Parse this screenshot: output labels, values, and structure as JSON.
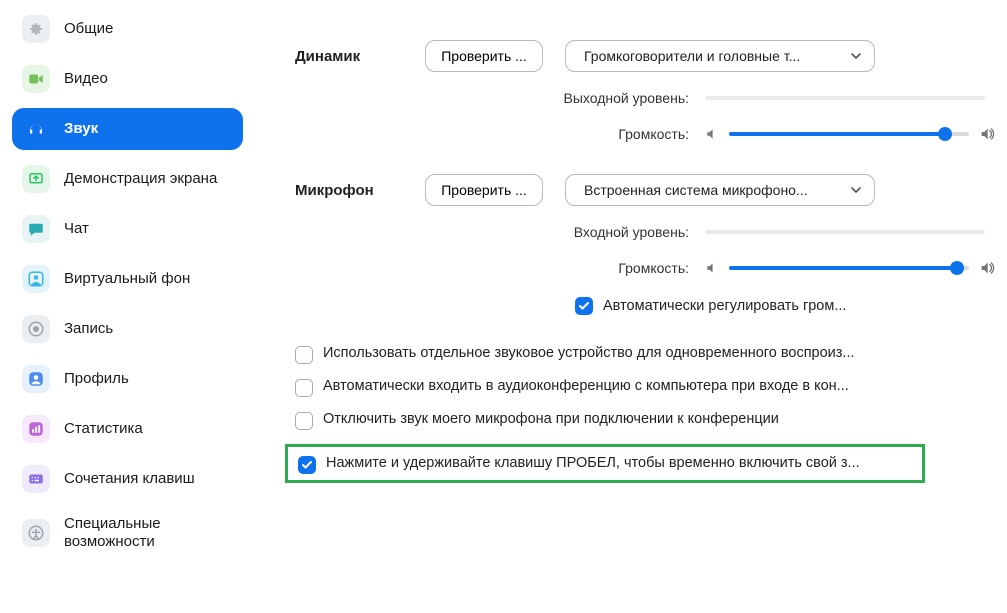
{
  "sidebar": {
    "items": [
      {
        "id": "general",
        "label": "Общие",
        "icon": "gear",
        "iconBg": "#eceff2",
        "iconFg": "#b1b7bd"
      },
      {
        "id": "video",
        "label": "Видео",
        "icon": "video",
        "iconBg": "#e7f6e5",
        "iconFg": "#76c05b"
      },
      {
        "id": "audio",
        "label": "Звук",
        "icon": "headphones",
        "iconBg": "#0e72ed",
        "iconFg": "#ffffff",
        "active": true
      },
      {
        "id": "share",
        "label": "Демонстрация экрана",
        "icon": "share",
        "iconBg": "#e6f7ea",
        "iconFg": "#28c466"
      },
      {
        "id": "chat",
        "label": "Чат",
        "icon": "chat",
        "iconBg": "#e7f3f4",
        "iconFg": "#2aaab0"
      },
      {
        "id": "vbg",
        "label": "Виртуальный фон",
        "icon": "person",
        "iconBg": "#e5f4fb",
        "iconFg": "#35b8e8"
      },
      {
        "id": "recording",
        "label": "Запись",
        "icon": "record",
        "iconBg": "#eceff2",
        "iconFg": "#9da3ab"
      },
      {
        "id": "profile",
        "label": "Профиль",
        "icon": "profile",
        "iconBg": "#e7f0fd",
        "iconFg": "#4f8ef0"
      },
      {
        "id": "stats",
        "label": "Статистика",
        "icon": "stats",
        "iconBg": "#f6e9f9",
        "iconFg": "#bd66d8"
      },
      {
        "id": "shortcuts",
        "label": "Сочетания клавиш",
        "icon": "keyboard",
        "iconBg": "#efeafc",
        "iconFg": "#8a6fe8"
      },
      {
        "id": "access",
        "label": "Специальные возможности",
        "icon": "access",
        "iconBg": "#eceff2",
        "iconFg": "#9da3ab"
      }
    ]
  },
  "speaker": {
    "heading": "Динамик",
    "test_btn": "Проверить ...",
    "device_selected": "Громкоговорители и головные т...",
    "output_level_label": "Выходной уровень:",
    "volume_label": "Громкость:",
    "volume_percent": 90
  },
  "mic": {
    "heading": "Микрофон",
    "test_btn": "Проверить ...",
    "device_selected": "Встроенная система микрофоно...",
    "input_level_label": "Входной уровень:",
    "volume_label": "Громкость:",
    "volume_percent": 95,
    "auto_gain_label": "Автоматически регулировать гром...",
    "auto_gain_checked": true
  },
  "options": [
    {
      "id": "separate_device",
      "checked": false,
      "label": "Использовать отдельное звуковое устройство для одновременного воспроиз..."
    },
    {
      "id": "auto_join_audio",
      "checked": false,
      "label": "Автоматически входить в аудиоконференцию с компьютера при входе в кон..."
    },
    {
      "id": "mute_on_join",
      "checked": false,
      "label": "Отключить звук моего микрофона при подключении к конференции"
    },
    {
      "id": "push_to_talk",
      "checked": true,
      "label": "Нажмите и удерживайте клавишу ПРОБЕЛ, чтобы временно включить свой з...",
      "highlight": true
    }
  ]
}
